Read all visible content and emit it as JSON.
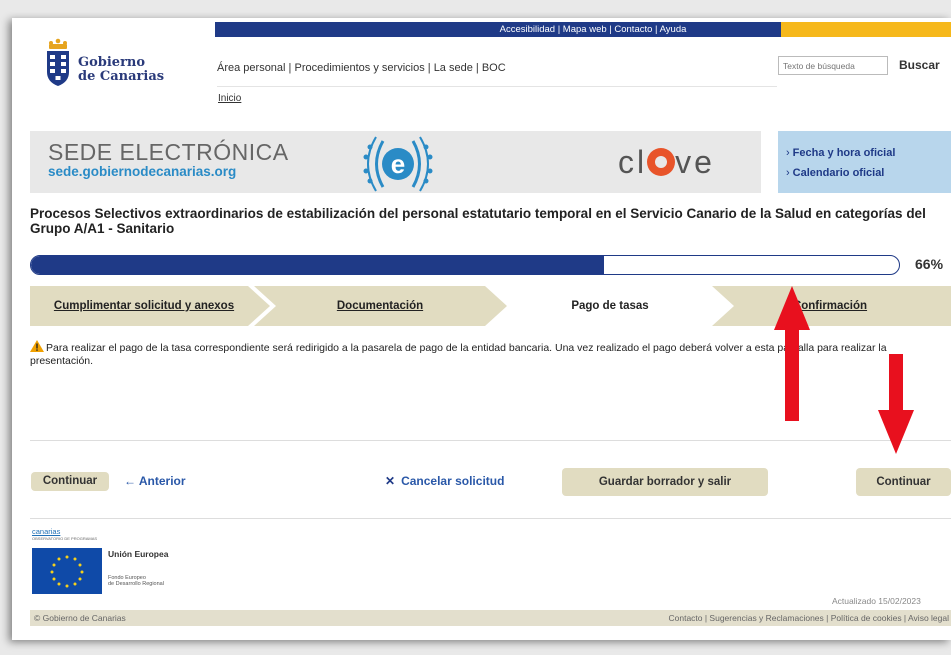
{
  "topbar": {
    "links": "Accesibilidad | Mapa web | Contacto | Ayuda"
  },
  "logo": {
    "line1": "Gobierno",
    "line2": "de Canarias"
  },
  "nav": {
    "area_personal": "Área personal",
    "procedimientos": "Procedimientos y servicios",
    "sede": "La sede",
    "boc": "BOC",
    "inicio": "Inicio",
    "sep": " | "
  },
  "search": {
    "placeholder": "Texto de búsqueda",
    "button": "Buscar"
  },
  "banner": {
    "title": "SEDE ELECTRÓNICA",
    "url": "sede.gobiernodecanarias.org",
    "clave_pre": "cl",
    "clave_post": "ve",
    "e_letter": "e"
  },
  "sidelinks": {
    "fecha": "Fecha y hora oficial",
    "calendario": "Calendario oficial",
    "arrow": "›"
  },
  "procedure_title": "Procesos Selectivos extraordinarios de estabilización del personal estatutario temporal en el Servicio Canario de la Salud en categorías del Grupo A/A1 - Sanitario",
  "progress": {
    "value": 0.66,
    "label": "66%"
  },
  "steps": [
    {
      "label": "Cumplimentar solicitud y anexos",
      "state": "done"
    },
    {
      "label": "Documentación",
      "state": "done"
    },
    {
      "label": "Pago de tasas",
      "state": "current"
    },
    {
      "label": "Confirmación",
      "state": "pending"
    }
  ],
  "warning_text": "Para realizar el pago de la tasa correspondiente será redirigido a la pasarela de pago de la entidad bancaria. Una vez realizado el pago deberá volver a esta pantalla para realizar la presentación.",
  "buttons": {
    "continuar_small": "Continuar",
    "anterior": "Anterior",
    "anterior_arrow": "←",
    "cancelar": "Cancelar solicitud",
    "cancelar_x": "✕",
    "guardar": "Guardar borrador y salir",
    "continuar": "Continuar"
  },
  "footer": {
    "canarias": "canarias",
    "canarias_sub": "OBSERVATORIO DE PROGRAMAS",
    "eu_title": "Unión Europea",
    "eu_fund_1": "Fondo Europeo",
    "eu_fund_2": "de Desarrollo Regional",
    "updated": "Actualizado 15/02/2023",
    "copyright": "© Gobierno de Canarias",
    "links": "Contacto | Sugerencias y Reclamaciones | Política de cookies | Aviso legal"
  },
  "colors": {
    "navy": "#1f3a87",
    "yellow": "#f6b81b",
    "step_bg": "#e1dcc1",
    "red_arrow": "#e8101e",
    "banner_blue": "#2a8bc6"
  }
}
